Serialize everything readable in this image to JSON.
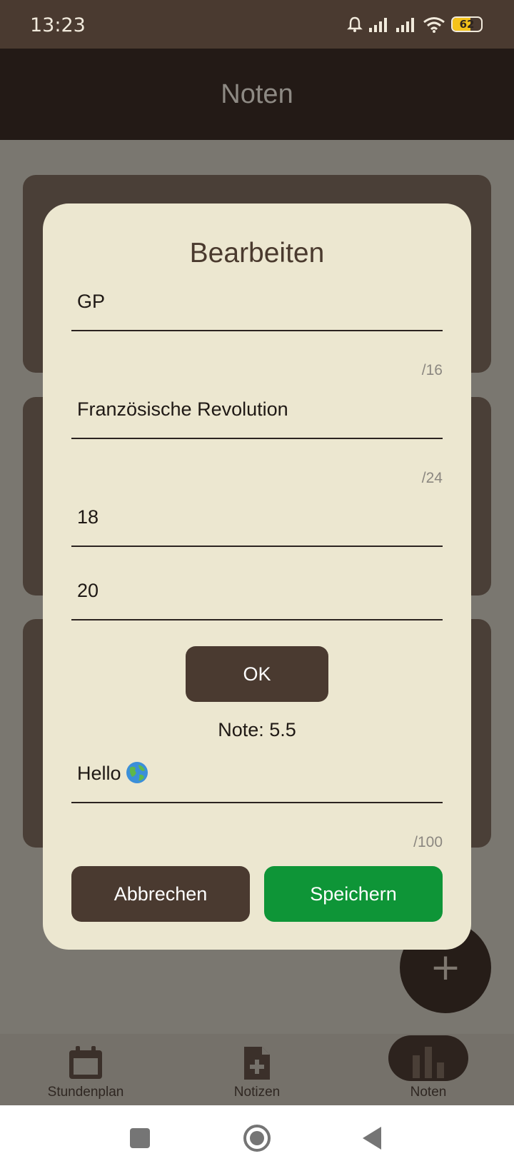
{
  "status_bar": {
    "time": "13:23",
    "battery": {
      "level": "62",
      "fill_fraction": 0.62,
      "color": "#f4c21a"
    },
    "icons": [
      "bell-icon",
      "signal-icon",
      "signal-icon",
      "wifi-icon",
      "battery-icon"
    ]
  },
  "app_bar": {
    "title": "Noten"
  },
  "background_cards_count": 3,
  "fab": {
    "icon": "plus-icon"
  },
  "bottom_nav": {
    "items": [
      {
        "label": "Stundenplan",
        "icon": "calendar-icon"
      },
      {
        "label": "Notizen",
        "icon": "note-add-icon"
      },
      {
        "label": "Noten",
        "icon": "bar-chart-icon",
        "active": true
      }
    ]
  },
  "system_nav": {
    "icons": [
      "recents-icon",
      "home-icon",
      "back-icon"
    ]
  },
  "dialog": {
    "title": "Bearbeiten",
    "fields": {
      "subject": {
        "value": "GP",
        "counter": "/16"
      },
      "topic": {
        "value": "Französische Revolution",
        "counter": "/24"
      },
      "points": {
        "value": "18"
      },
      "max_points": {
        "value": "20"
      },
      "comment": {
        "value": "Hello",
        "emoji": "globe-icon",
        "counter": "/100"
      }
    },
    "ok_label": "OK",
    "grade_text": "Note: 5.5",
    "cancel_label": "Abbrechen",
    "save_label": "Speichern"
  },
  "colors": {
    "status_bar": "#4a3a30",
    "app_bar": "#231a16",
    "dialog_bg": "#ece7d0",
    "primary_brown": "#4a3a30",
    "save_green": "#0e9537",
    "scrim": "#7a7770"
  }
}
